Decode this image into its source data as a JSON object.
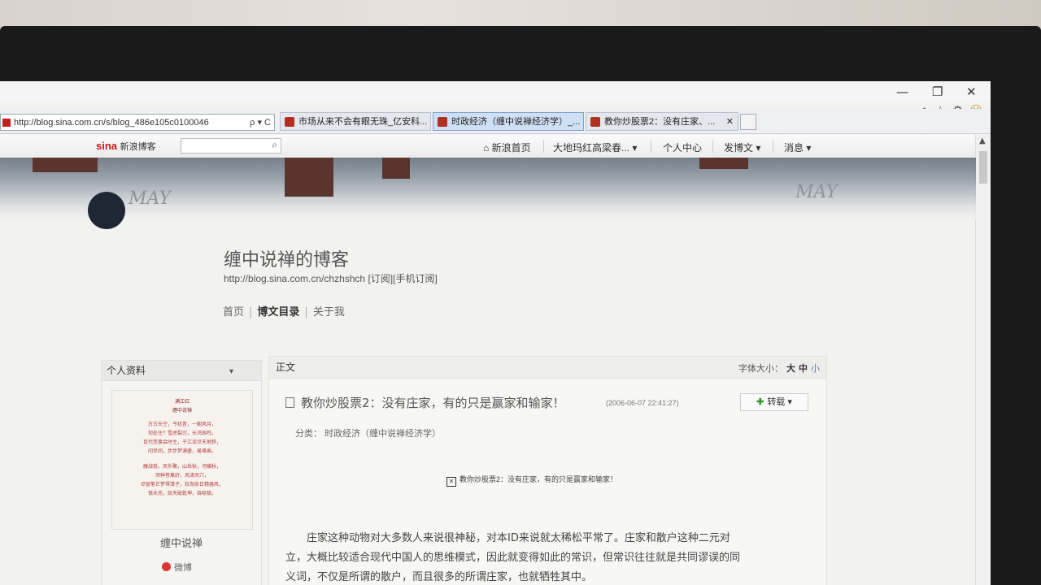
{
  "browser": {
    "address": "http://blog.sina.com.cn/s/blog_486e105c0100046",
    "addr_tools": "ρ ▾ C",
    "window_controls": [
      "—",
      "❐",
      "✕"
    ],
    "tabs": [
      {
        "label": "市场从来不会有眼无珠_亿安科..."
      },
      {
        "label": "时政经济（缠中说禅经济学）_..."
      },
      {
        "label": "教你炒股票2：没有庄家、..."
      }
    ],
    "tab_close": "✕",
    "icons": [
      "home-icon",
      "star-icon",
      "gear-icon",
      "smiley-icon"
    ]
  },
  "sina_bar": {
    "logo": "sina",
    "logo_sub": "新浪博客",
    "search_placeholder": "",
    "nav": [
      "⌂ 新浪首页",
      "大地玛红高梁春... ▾",
      "个人中心",
      "发博文 ▾",
      "消息 ▾"
    ]
  },
  "header": {
    "may_left": "MAY",
    "may_right": "MAY"
  },
  "blog": {
    "title": "缠中说禅的博客",
    "url": "http://blog.sina.com.cn/chzhshch",
    "subscribe": "[订阅]",
    "mobile_subscribe": "[手机订阅]",
    "nav": {
      "home": "首页",
      "catalog": "博文目录",
      "about": "关于我"
    }
  },
  "profile": {
    "head": "个人资料",
    "caret": "▾",
    "poem_title": [
      "满江红",
      "缠中说禅"
    ],
    "poem_lines": [
      "万古长空，今犹昔，一朝风月，",
      "何处住？雪虎裂刃，长鸿哀鸣，",
      "百代悲事会时主，于江流尽天地狭，",
      "问世间，步步梦满盛，易难乘。",
      "",
      "魔战祇，天外聚，山岳秋，河横秋，",
      "须种菩萬好，风涛天穴，",
      "尽驱笔芒梦得清子，狂淘奈日精器风，",
      "恨未充，奴天破乾坤，吞吸极。"
    ],
    "name": "缠中说禅",
    "weibo": "微博"
  },
  "article": {
    "panel_head": "正文",
    "font_size_label": "字体大小：",
    "font_sizes": [
      "大",
      "中",
      "小"
    ],
    "title": "教你炒股票2：没有庄家，有的只是赢家和输家！",
    "date": "(2006-06-07 22:41:27)",
    "repost": "转载",
    "repost_caret": "▾",
    "category": "分类：  时政经济（缠中说禅经济学）",
    "image_alt": "教你炒股票2：没有庄家，有的只是赢家和输家！",
    "paragraph": [
      "　　庄家这种动物对大多数人来说很神秘，对本ID来说就太稀松平常了。庄家和散户这种二元对",
      "立，大概比较适合现代中国人的思维模式，因此就变得如此的常识，但常识往往就是共同谬误的同",
      "义词，不仅是所谓的散户，而且很多的所谓庄家，也就牺牲其中。"
    ]
  }
}
